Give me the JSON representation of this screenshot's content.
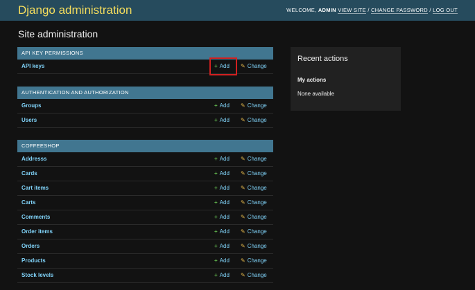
{
  "header": {
    "branding": "Django administration",
    "welcome": "WELCOME,",
    "username": "ADMIN",
    "view_site": "VIEW SITE",
    "change_password": "CHANGE PASSWORD",
    "log_out": "LOG OUT",
    "separator": "/"
  },
  "page_title": "Site administration",
  "labels": {
    "add": "Add",
    "change": "Change"
  },
  "modules": [
    {
      "caption": "API KEY PERMISSIONS",
      "models": [
        "API keys"
      ]
    },
    {
      "caption": "AUTHENTICATION AND AUTHORIZATION",
      "models": [
        "Groups",
        "Users"
      ]
    },
    {
      "caption": "COFFEESHOP",
      "models": [
        "Addresss",
        "Cards",
        "Cart items",
        "Carts",
        "Comments",
        "Order items",
        "Orders",
        "Products",
        "Stock levels"
      ]
    }
  ],
  "recent_actions": {
    "title": "Recent actions",
    "my_actions": "My actions",
    "none": "None available"
  },
  "colors": {
    "header_bg": "#264b5d",
    "branding": "#f5dd5d",
    "caption_bg": "#417690",
    "link": "#81d4fa",
    "add_icon": "#5fb04c",
    "change_icon": "#e4b94c",
    "highlight": "#d22020"
  },
  "icons": {
    "add": "plus-icon",
    "change": "pencil-icon"
  }
}
